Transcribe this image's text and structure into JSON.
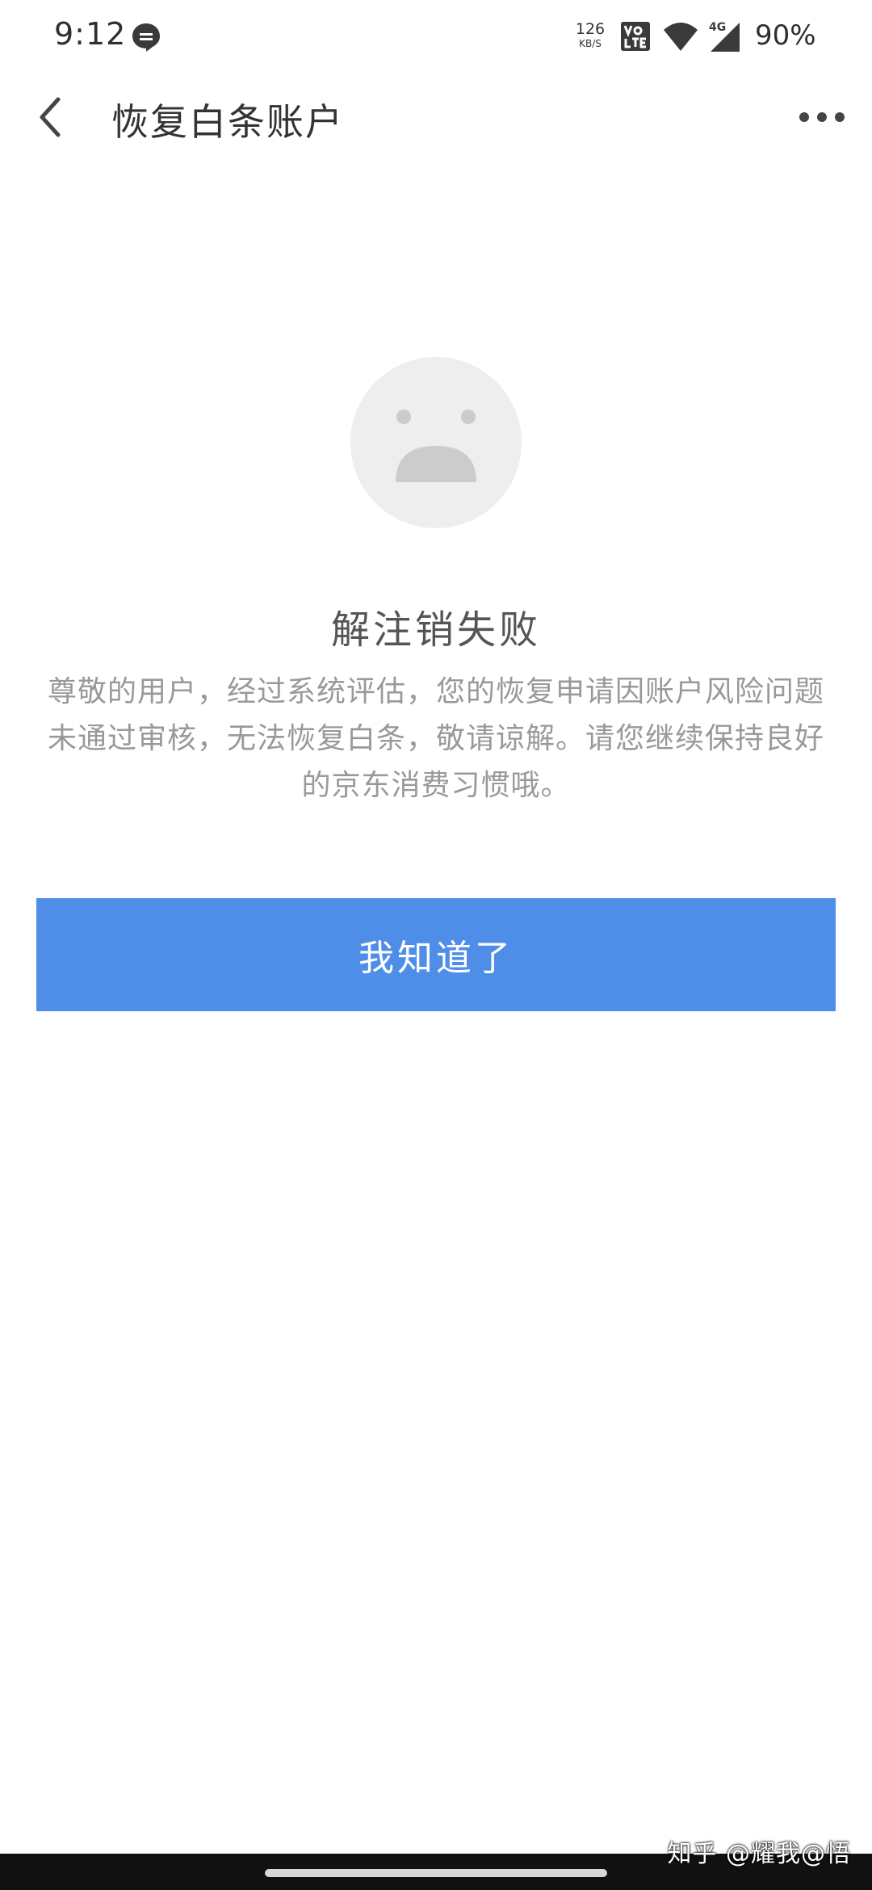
{
  "status_bar": {
    "time": "9:12",
    "net_speed_value": "126",
    "net_speed_unit": "KB/S",
    "network_type": "4G",
    "battery": "90%"
  },
  "nav": {
    "title": "恢复白条账户"
  },
  "result": {
    "title": "解注销失败",
    "message": "尊敬的用户，经过系统评估，您的恢复申请因账户风险问题未通过审核，无法恢复白条，敬请谅解。请您继续保持良好的京东消费习惯哦。"
  },
  "actions": {
    "confirm_label": "我知道了"
  },
  "watermark": {
    "text": "知乎 @耀我@悟"
  },
  "colors": {
    "primary_button": "#4f8ee8",
    "face_bg": "#eeeeee",
    "face_features": "#cccccc"
  }
}
